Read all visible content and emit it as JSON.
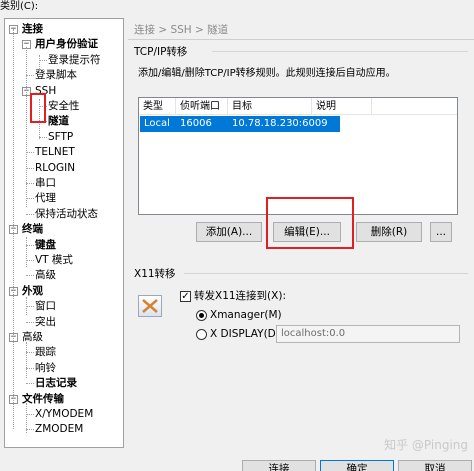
{
  "category_label": "类别(C):",
  "tree": [
    {
      "label": "连接",
      "bold": true,
      "level": 0,
      "toggle": "-"
    },
    {
      "label": "用户身份验证",
      "bold": true,
      "level": 1,
      "toggle": "-"
    },
    {
      "label": "登录提示符",
      "bold": false,
      "level": 2
    },
    {
      "label": "登录脚本",
      "bold": false,
      "level": 1
    },
    {
      "label": "SSH",
      "bold": false,
      "level": 1,
      "toggle": "-"
    },
    {
      "label": "安全性",
      "bold": false,
      "level": 2
    },
    {
      "label": "隧道",
      "bold": true,
      "level": 2
    },
    {
      "label": "SFTP",
      "bold": false,
      "level": 2
    },
    {
      "label": "TELNET",
      "bold": false,
      "level": 1
    },
    {
      "label": "RLOGIN",
      "bold": false,
      "level": 1
    },
    {
      "label": "串口",
      "bold": false,
      "level": 1
    },
    {
      "label": "代理",
      "bold": false,
      "level": 1
    },
    {
      "label": "保持活动状态",
      "bold": false,
      "level": 1
    },
    {
      "label": "终端",
      "bold": true,
      "level": 0,
      "toggle": "-"
    },
    {
      "label": "键盘",
      "bold": true,
      "level": 1
    },
    {
      "label": "VT 模式",
      "bold": false,
      "level": 1
    },
    {
      "label": "高级",
      "bold": false,
      "level": 1
    },
    {
      "label": "外观",
      "bold": true,
      "level": 0,
      "toggle": "-"
    },
    {
      "label": "窗口",
      "bold": false,
      "level": 1
    },
    {
      "label": "突出",
      "bold": false,
      "level": 1
    },
    {
      "label": "高级",
      "bold": false,
      "level": 0,
      "toggle": "-"
    },
    {
      "label": "跟踪",
      "bold": false,
      "level": 1
    },
    {
      "label": "响铃",
      "bold": false,
      "level": 1
    },
    {
      "label": "日志记录",
      "bold": true,
      "level": 1
    },
    {
      "label": "文件传输",
      "bold": true,
      "level": 0,
      "toggle": "-"
    },
    {
      "label": "X/YMODEM",
      "bold": false,
      "level": 1
    },
    {
      "label": "ZMODEM",
      "bold": false,
      "level": 1
    }
  ],
  "breadcrumb": "连接 > SSH > 隧道",
  "tcpip": {
    "group_label": "TCP/IP转移",
    "description": "添加/编辑/删除TCP/IP转移规则。此规则连接后自动应用。",
    "columns": [
      "类型",
      "侦听端口",
      "目标",
      "说明"
    ],
    "rows": [
      {
        "type": "Local",
        "port": "16006",
        "target": "10.78.18.230:6009",
        "note": ""
      }
    ],
    "add_button": "添加(A)...",
    "edit_button": "编辑(E)...",
    "delete_button": "删除(R)",
    "more_button": "..."
  },
  "x11": {
    "group_label": "X11转移",
    "forward_label": "转发X11连接到(X):",
    "forward_checked": true,
    "xmanager_label": "Xmanager(M)",
    "xdisplay_label": "X DISPLAY(D):",
    "xdisplay_value": "localhost:0.0",
    "selected": "xmanager"
  },
  "watermark": "知乎 @Pinging",
  "footer": {
    "connect_button": "连接",
    "ok_button": "确定",
    "cancel_button": "取消"
  },
  "colors": {
    "highlight_red": "#e02020",
    "selection_blue": "#0078d7"
  }
}
